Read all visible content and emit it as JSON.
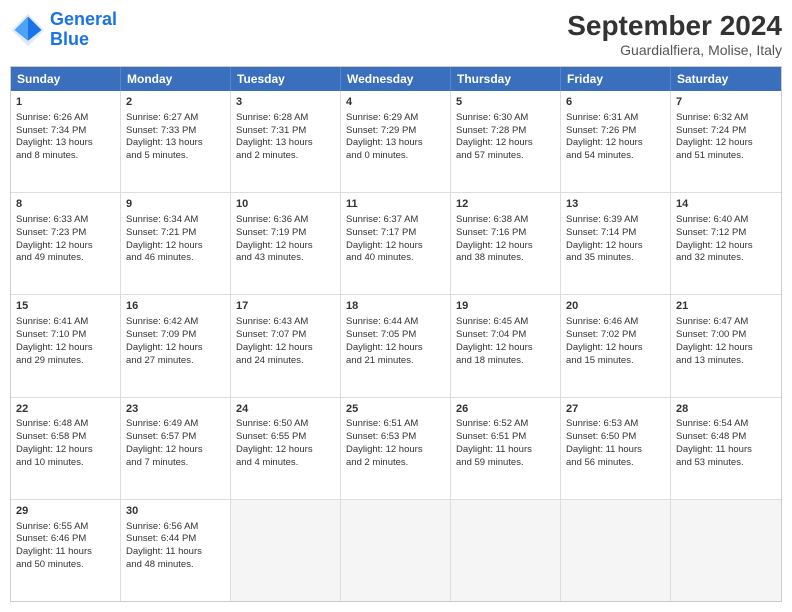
{
  "header": {
    "logo_line1": "General",
    "logo_line2": "Blue",
    "month": "September 2024",
    "location": "Guardialfiera, Molise, Italy"
  },
  "days_of_week": [
    "Sunday",
    "Monday",
    "Tuesday",
    "Wednesday",
    "Thursday",
    "Friday",
    "Saturday"
  ],
  "rows": [
    [
      {
        "day": "1",
        "info": "Sunrise: 6:26 AM\nSunset: 7:34 PM\nDaylight: 13 hours\nand 8 minutes."
      },
      {
        "day": "2",
        "info": "Sunrise: 6:27 AM\nSunset: 7:33 PM\nDaylight: 13 hours\nand 5 minutes."
      },
      {
        "day": "3",
        "info": "Sunrise: 6:28 AM\nSunset: 7:31 PM\nDaylight: 13 hours\nand 2 minutes."
      },
      {
        "day": "4",
        "info": "Sunrise: 6:29 AM\nSunset: 7:29 PM\nDaylight: 13 hours\nand 0 minutes."
      },
      {
        "day": "5",
        "info": "Sunrise: 6:30 AM\nSunset: 7:28 PM\nDaylight: 12 hours\nand 57 minutes."
      },
      {
        "day": "6",
        "info": "Sunrise: 6:31 AM\nSunset: 7:26 PM\nDaylight: 12 hours\nand 54 minutes."
      },
      {
        "day": "7",
        "info": "Sunrise: 6:32 AM\nSunset: 7:24 PM\nDaylight: 12 hours\nand 51 minutes."
      }
    ],
    [
      {
        "day": "8",
        "info": "Sunrise: 6:33 AM\nSunset: 7:23 PM\nDaylight: 12 hours\nand 49 minutes."
      },
      {
        "day": "9",
        "info": "Sunrise: 6:34 AM\nSunset: 7:21 PM\nDaylight: 12 hours\nand 46 minutes."
      },
      {
        "day": "10",
        "info": "Sunrise: 6:36 AM\nSunset: 7:19 PM\nDaylight: 12 hours\nand 43 minutes."
      },
      {
        "day": "11",
        "info": "Sunrise: 6:37 AM\nSunset: 7:17 PM\nDaylight: 12 hours\nand 40 minutes."
      },
      {
        "day": "12",
        "info": "Sunrise: 6:38 AM\nSunset: 7:16 PM\nDaylight: 12 hours\nand 38 minutes."
      },
      {
        "day": "13",
        "info": "Sunrise: 6:39 AM\nSunset: 7:14 PM\nDaylight: 12 hours\nand 35 minutes."
      },
      {
        "day": "14",
        "info": "Sunrise: 6:40 AM\nSunset: 7:12 PM\nDaylight: 12 hours\nand 32 minutes."
      }
    ],
    [
      {
        "day": "15",
        "info": "Sunrise: 6:41 AM\nSunset: 7:10 PM\nDaylight: 12 hours\nand 29 minutes."
      },
      {
        "day": "16",
        "info": "Sunrise: 6:42 AM\nSunset: 7:09 PM\nDaylight: 12 hours\nand 27 minutes."
      },
      {
        "day": "17",
        "info": "Sunrise: 6:43 AM\nSunset: 7:07 PM\nDaylight: 12 hours\nand 24 minutes."
      },
      {
        "day": "18",
        "info": "Sunrise: 6:44 AM\nSunset: 7:05 PM\nDaylight: 12 hours\nand 21 minutes."
      },
      {
        "day": "19",
        "info": "Sunrise: 6:45 AM\nSunset: 7:04 PM\nDaylight: 12 hours\nand 18 minutes."
      },
      {
        "day": "20",
        "info": "Sunrise: 6:46 AM\nSunset: 7:02 PM\nDaylight: 12 hours\nand 15 minutes."
      },
      {
        "day": "21",
        "info": "Sunrise: 6:47 AM\nSunset: 7:00 PM\nDaylight: 12 hours\nand 13 minutes."
      }
    ],
    [
      {
        "day": "22",
        "info": "Sunrise: 6:48 AM\nSunset: 6:58 PM\nDaylight: 12 hours\nand 10 minutes."
      },
      {
        "day": "23",
        "info": "Sunrise: 6:49 AM\nSunset: 6:57 PM\nDaylight: 12 hours\nand 7 minutes."
      },
      {
        "day": "24",
        "info": "Sunrise: 6:50 AM\nSunset: 6:55 PM\nDaylight: 12 hours\nand 4 minutes."
      },
      {
        "day": "25",
        "info": "Sunrise: 6:51 AM\nSunset: 6:53 PM\nDaylight: 12 hours\nand 2 minutes."
      },
      {
        "day": "26",
        "info": "Sunrise: 6:52 AM\nSunset: 6:51 PM\nDaylight: 11 hours\nand 59 minutes."
      },
      {
        "day": "27",
        "info": "Sunrise: 6:53 AM\nSunset: 6:50 PM\nDaylight: 11 hours\nand 56 minutes."
      },
      {
        "day": "28",
        "info": "Sunrise: 6:54 AM\nSunset: 6:48 PM\nDaylight: 11 hours\nand 53 minutes."
      }
    ],
    [
      {
        "day": "29",
        "info": "Sunrise: 6:55 AM\nSunset: 6:46 PM\nDaylight: 11 hours\nand 50 minutes."
      },
      {
        "day": "30",
        "info": "Sunrise: 6:56 AM\nSunset: 6:44 PM\nDaylight: 11 hours\nand 48 minutes."
      },
      {
        "day": "",
        "info": "",
        "empty": true
      },
      {
        "day": "",
        "info": "",
        "empty": true
      },
      {
        "day": "",
        "info": "",
        "empty": true
      },
      {
        "day": "",
        "info": "",
        "empty": true
      },
      {
        "day": "",
        "info": "",
        "empty": true
      }
    ]
  ]
}
